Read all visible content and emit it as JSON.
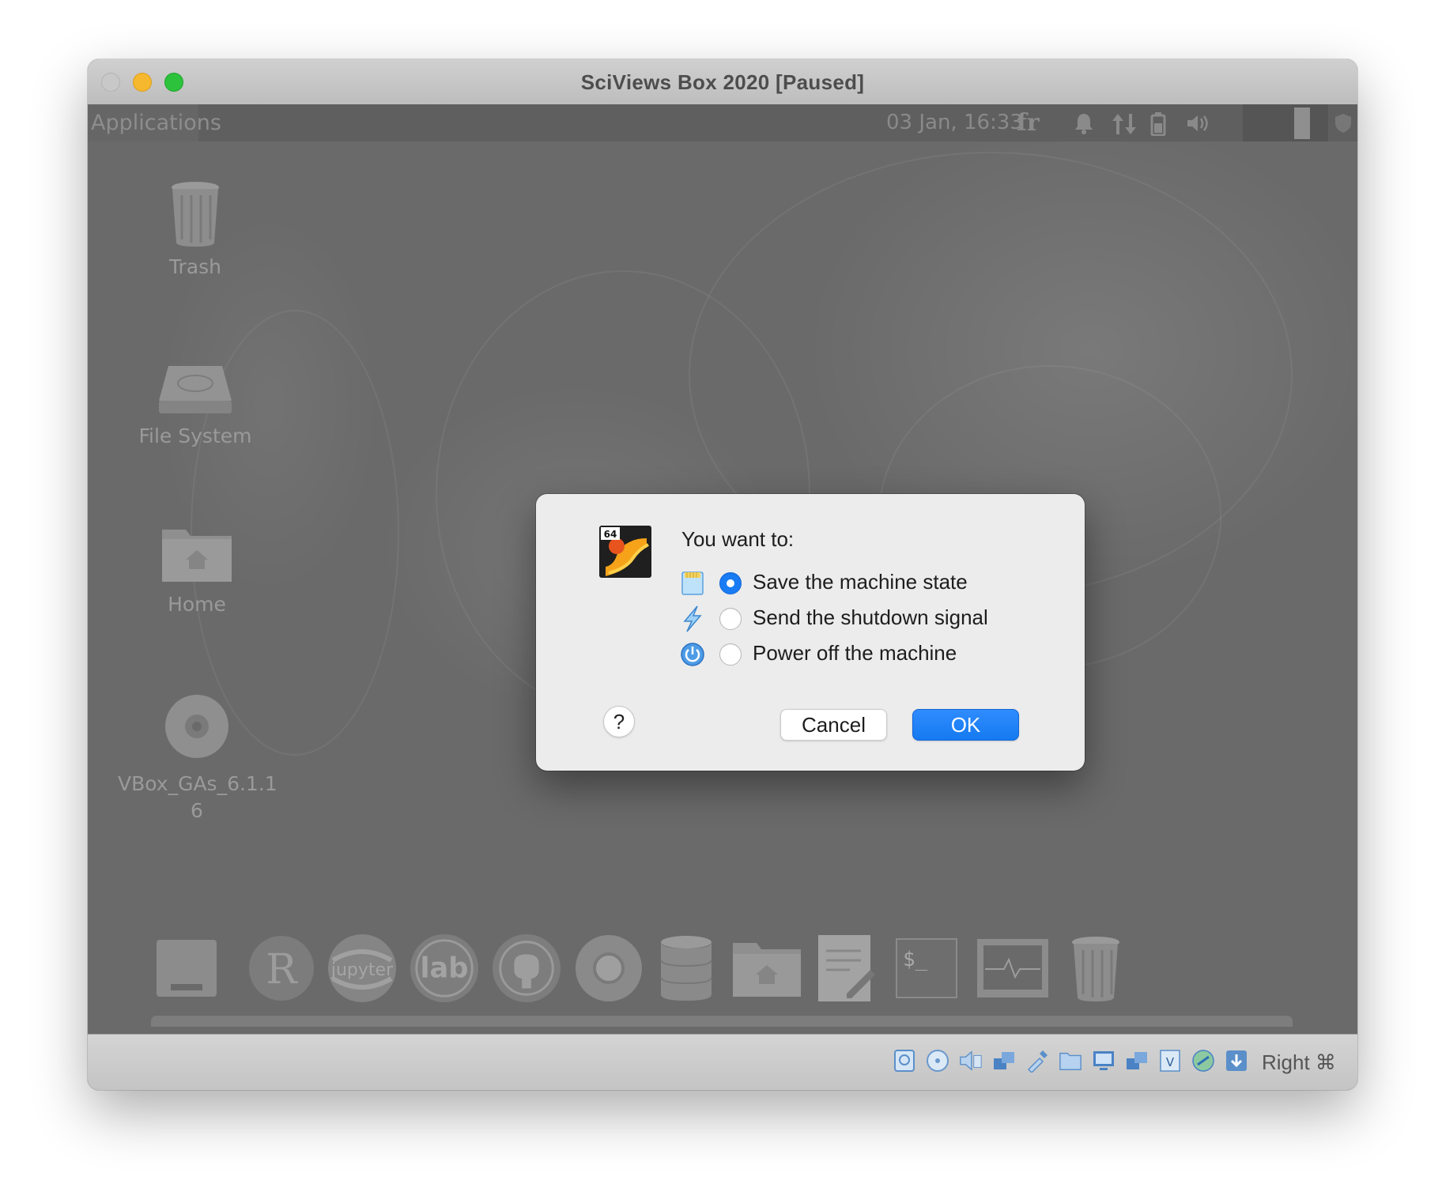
{
  "window": {
    "title": "SciViews Box 2020 [Paused]"
  },
  "guest_panel": {
    "applications_label": "Applications",
    "clock": "03 Jan, 16:33",
    "keyboard_layout": "fr"
  },
  "desktop_icons": [
    {
      "label": "Trash",
      "icon": "trash-icon"
    },
    {
      "label": "File System",
      "icon": "drive-icon"
    },
    {
      "label": "Home",
      "icon": "home-folder-icon"
    },
    {
      "label": "VBox_GAs_6.1.1\n6",
      "line1": "VBox_GAs_6.1.1",
      "line2": "6",
      "icon": "cd-icon"
    }
  ],
  "dock": {
    "items": [
      {
        "icon": "drive-icon"
      },
      {
        "icon": "r-icon",
        "text": "R"
      },
      {
        "icon": "jupyter-icon",
        "text": "jupyter"
      },
      {
        "icon": "jupyterlab-icon",
        "text": "lab"
      },
      {
        "icon": "github-icon"
      },
      {
        "icon": "chrome-icon"
      },
      {
        "icon": "database-icon"
      },
      {
        "icon": "home-folder-icon"
      },
      {
        "icon": "text-editor-icon"
      },
      {
        "icon": "terminal-icon",
        "text": "$_"
      },
      {
        "icon": "system-monitor-icon"
      },
      {
        "icon": "trash-icon"
      }
    ]
  },
  "dialog": {
    "prompt": "You want to:",
    "options": [
      {
        "label": "Save the machine state",
        "icon": "save-state-icon",
        "selected": true
      },
      {
        "label": "Send the shutdown signal",
        "icon": "acpi-shutdown-icon",
        "selected": false
      },
      {
        "label": "Power off the machine",
        "icon": "power-icon",
        "selected": false
      }
    ],
    "help_label": "?",
    "cancel_label": "Cancel",
    "ok_label": "OK",
    "badge": "64"
  },
  "statusbar": {
    "host_key": "Right ⌘",
    "icons": [
      "hard-disk-icon",
      "optical-drive-icon",
      "audio-icon",
      "network-icon",
      "usb-icon",
      "shared-folder-icon",
      "display-icon",
      "video-capture-icon",
      "recording-icon",
      "cpu-icon",
      "mouse-integration-icon",
      "keyboard-icon"
    ]
  },
  "colors": {
    "accent": "#1a7cf4",
    "close": "#c8c8c8",
    "minimize": "#f5b82e",
    "maximize": "#2dc23c"
  }
}
